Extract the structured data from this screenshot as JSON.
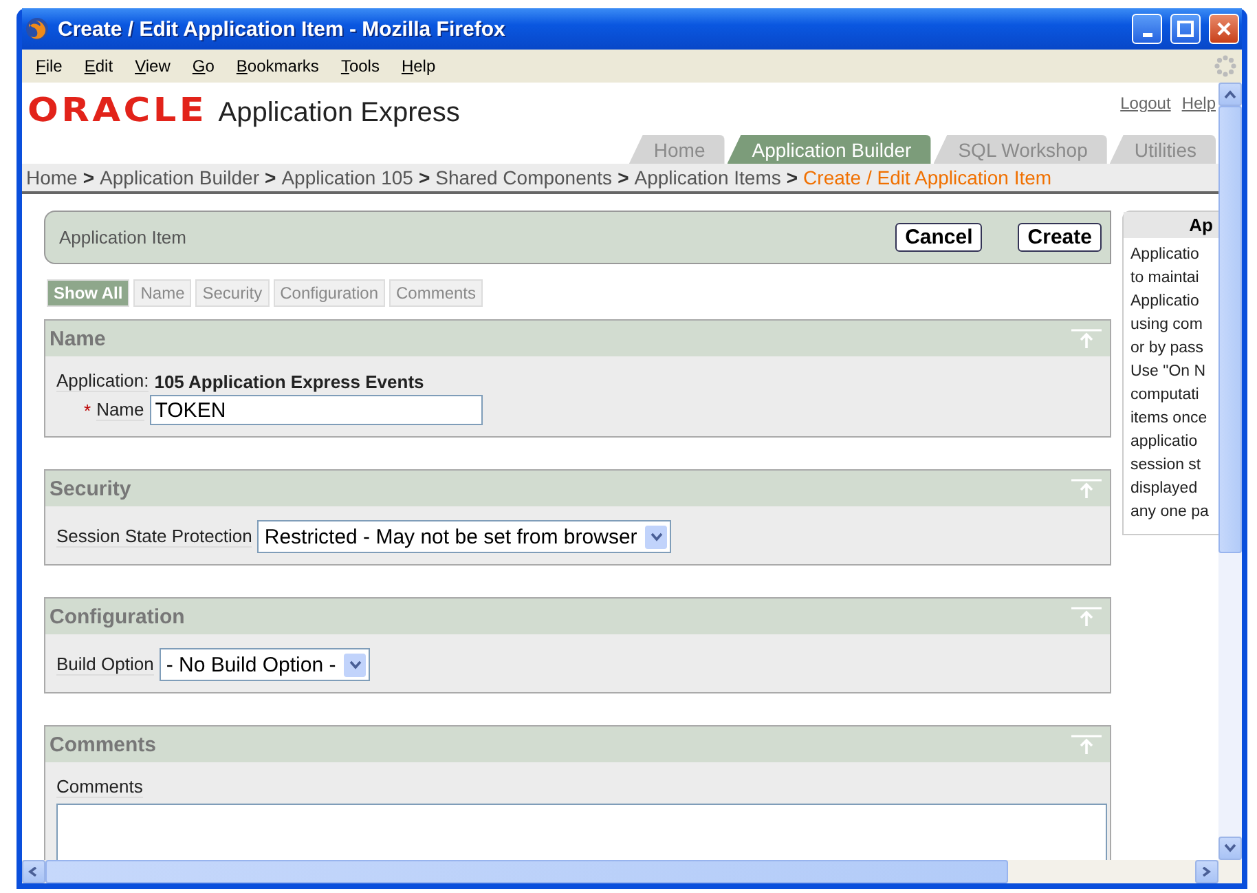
{
  "window": {
    "title": "Create / Edit Application Item - Mozilla Firefox"
  },
  "menu": [
    {
      "label": "File"
    },
    {
      "label": "Edit"
    },
    {
      "label": "View"
    },
    {
      "label": "Go"
    },
    {
      "label": "Bookmarks"
    },
    {
      "label": "Tools"
    },
    {
      "label": "Help"
    }
  ],
  "header": {
    "logo": "ORACLE",
    "product": "Application Express",
    "links": [
      "Logout",
      "Help"
    ]
  },
  "tabs": [
    {
      "label": "Home",
      "selected": false
    },
    {
      "label": "Application Builder",
      "selected": true
    },
    {
      "label": "SQL Workshop",
      "selected": false
    },
    {
      "label": "Utilities",
      "selected": false
    }
  ],
  "breadcrumb": [
    {
      "kind": "link",
      "label": "Home",
      "current": false
    },
    {
      "kind": "separator",
      "label": ">"
    },
    {
      "kind": "link",
      "label": "Application Builder",
      "current": false
    },
    {
      "kind": "separator",
      "label": ">"
    },
    {
      "kind": "link",
      "label": "Application 105",
      "current": false
    },
    {
      "kind": "separator",
      "label": ">"
    },
    {
      "kind": "link",
      "label": "Shared Components",
      "current": false
    },
    {
      "kind": "separator",
      "label": ">"
    },
    {
      "kind": "link",
      "label": "Application Items",
      "current": false
    },
    {
      "kind": "separator",
      "label": ">"
    },
    {
      "kind": "link",
      "label": "Create / Edit Application Item",
      "current": true
    }
  ],
  "region": {
    "title": "Application Item",
    "buttons": [
      "Cancel",
      "Create"
    ]
  },
  "section_links": [
    {
      "label": "Show All",
      "selected": true
    },
    {
      "label": "Name",
      "selected": false
    },
    {
      "label": "Security",
      "selected": false
    },
    {
      "label": "Configuration",
      "selected": false
    },
    {
      "label": "Comments",
      "selected": false
    }
  ],
  "sections": [
    {
      "title": "Name",
      "fields": [
        {
          "kind": "display",
          "label": "Application:",
          "value": "105 Application Express Events"
        },
        {
          "kind": "text",
          "label": "Name",
          "required_mark": "*",
          "value": "TOKEN"
        }
      ]
    },
    {
      "title": "Security",
      "fields": [
        {
          "kind": "select",
          "label": "Session State Protection",
          "value": "Restricted - May not be set from browser"
        }
      ]
    },
    {
      "title": "Configuration",
      "fields": [
        {
          "kind": "select",
          "label": "Build Option",
          "value": "- No Build Option -"
        }
      ]
    },
    {
      "title": "Comments",
      "fields": [
        {
          "kind": "textarea",
          "label": "Comments"
        }
      ]
    }
  ],
  "help_panel": {
    "title": "Ap",
    "lines": [
      "Applicatio",
      "to maintai",
      "Applicatio",
      "using com",
      "or by pass",
      "Use \"On N",
      "computati",
      "items once",
      "applicatio",
      "session st",
      "displayed",
      "any one pa"
    ]
  }
}
